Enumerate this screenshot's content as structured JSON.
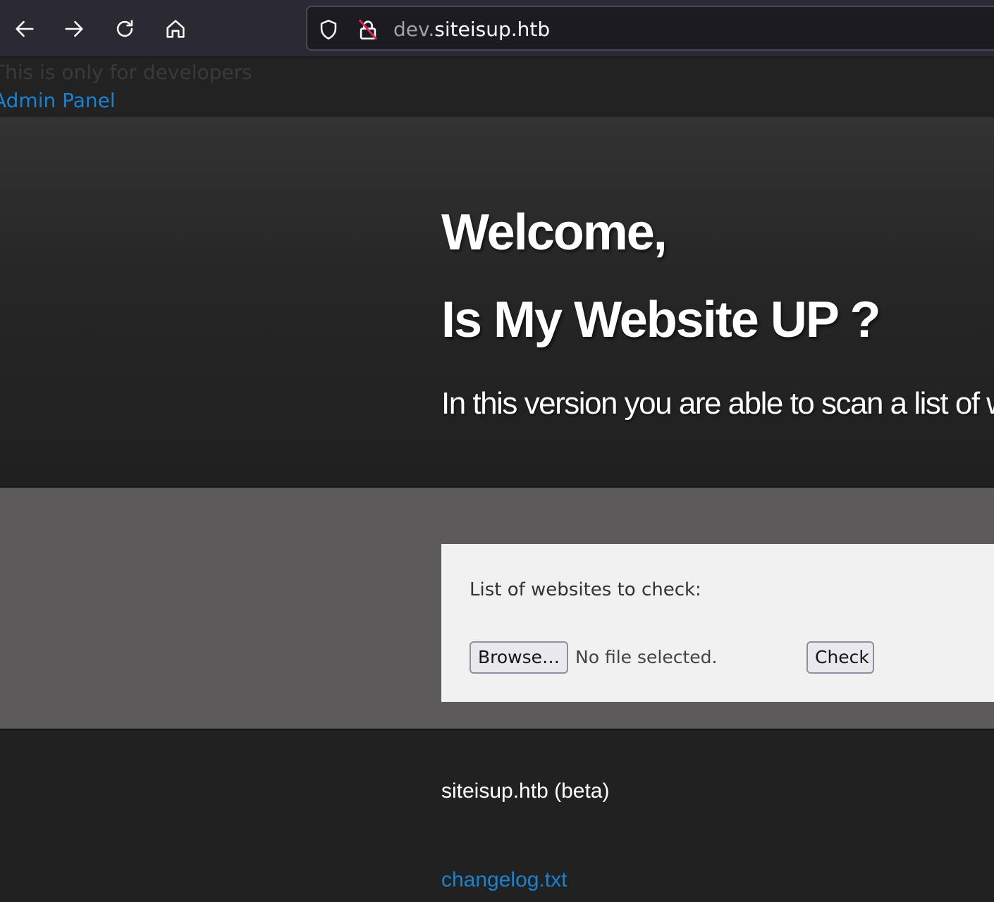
{
  "browser": {
    "url_subdomain": "dev.",
    "url_domain": "siteisup.htb",
    "icons": [
      "back-arrow-icon",
      "forward-arrow-icon",
      "reload-icon",
      "home-icon",
      "shield-icon",
      "insecure-lock-icon"
    ]
  },
  "dev_banner": {
    "note": "This is only for developers",
    "admin_link": "Admin Panel"
  },
  "hero": {
    "title_line1": "Welcome,",
    "title_line2": "Is My Website UP ?",
    "subtitle": "In this version you are able to scan a list of websites"
  },
  "form": {
    "label": "List of websites to check:",
    "browse_label": "Browse…",
    "file_status": "No file selected.",
    "check_label": "Check"
  },
  "footer": {
    "brand": "siteisup.htb (beta)",
    "changelog_link": "changelog.txt"
  },
  "colors": {
    "link": "#1a82d1",
    "hero_bg": "#262626",
    "form_section_bg": "#5c5a5b",
    "form_panel_bg": "#f1f1f1",
    "footer_bg": "#212121"
  }
}
